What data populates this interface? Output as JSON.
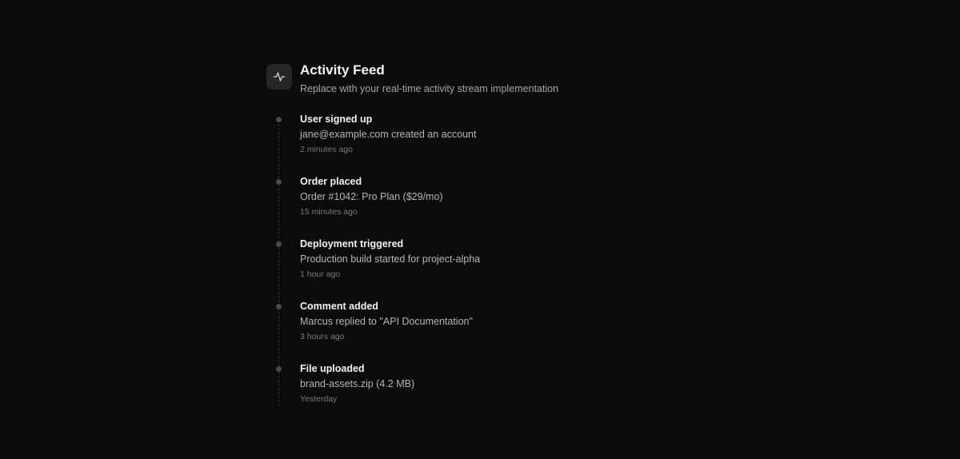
{
  "header": {
    "title": "Activity Feed",
    "subtitle": "Replace with your real-time activity stream implementation",
    "icon": "activity-icon"
  },
  "events": [
    {
      "title": "User signed up",
      "description": "jane@example.com created an account",
      "time": "2 minutes ago"
    },
    {
      "title": "Order placed",
      "description": "Order #1042: Pro Plan ($29/mo)",
      "time": "15 minutes ago"
    },
    {
      "title": "Deployment triggered",
      "description": "Production build started for project-alpha",
      "time": "1 hour ago"
    },
    {
      "title": "Comment added",
      "description": "Marcus replied to \"API Documentation\"",
      "time": "3 hours ago"
    },
    {
      "title": "File uploaded",
      "description": "brand-assets.zip (4.2 MB)",
      "time": "Yesterday"
    }
  ],
  "colors": {
    "background": "#0b0b0b",
    "icon_bg": "#262626",
    "dot": "#4a4a4a",
    "line": "#333333"
  }
}
